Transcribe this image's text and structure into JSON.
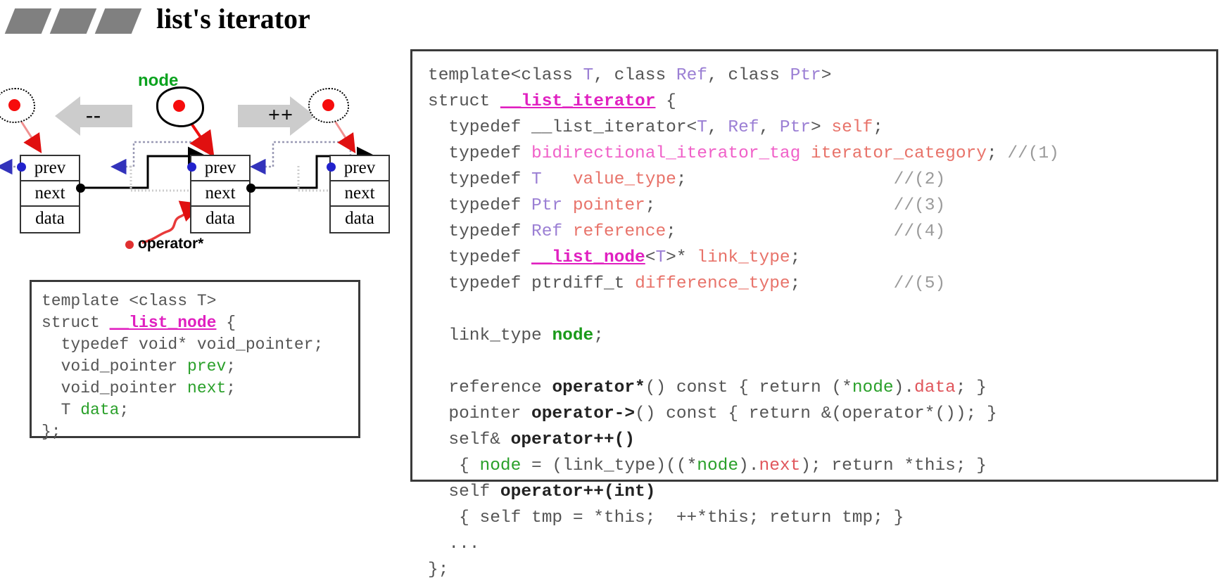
{
  "title": {
    "text": "list's iterator",
    "chevron_count": 3,
    "chevron_color": "#808080"
  },
  "diagram": {
    "node_label": "node",
    "node_label_color": "#0aa21e",
    "operator_star_label": "operator*",
    "decrement_sign": "--",
    "increment_sign": "++",
    "boxes": [
      {
        "name": "prev-node",
        "cells": [
          "prev",
          "next",
          "data"
        ]
      },
      {
        "name": "current-node",
        "cells": [
          "prev",
          "next",
          "data"
        ]
      },
      {
        "name": "next-node",
        "cells": [
          "prev",
          "next",
          "data"
        ]
      }
    ],
    "colors": {
      "iterator_dot": "#f60c0c",
      "prev_pointer_dot": "#2222cc",
      "next_pointer_dot": "#000000",
      "arrow_gray": "#cccccc",
      "operator_star_arrow": "#e03030"
    }
  },
  "code_list_node": {
    "lines": [
      [
        {
          "t": "template <class T>",
          "c": "plain"
        }
      ],
      [
        {
          "t": "struct ",
          "c": "plain"
        },
        {
          "t": "__list_node",
          "c": "magenta-u"
        },
        {
          "t": " {",
          "c": "plain"
        }
      ],
      [
        {
          "t": "  typedef void* void_pointer;",
          "c": "plain"
        }
      ],
      [
        {
          "t": "  void_pointer ",
          "c": "plain"
        },
        {
          "t": "prev",
          "c": "green"
        },
        {
          "t": ";",
          "c": "plain"
        }
      ],
      [
        {
          "t": "  void_pointer ",
          "c": "plain"
        },
        {
          "t": "next",
          "c": "green"
        },
        {
          "t": ";",
          "c": "plain"
        }
      ],
      [
        {
          "t": "  T ",
          "c": "plain"
        },
        {
          "t": "data",
          "c": "green"
        },
        {
          "t": ";",
          "c": "plain"
        }
      ],
      [
        {
          "t": "};",
          "c": "plain"
        }
      ]
    ]
  },
  "code_list_iterator": {
    "lines": [
      [
        {
          "t": "template<class ",
          "c": "plain"
        },
        {
          "t": "T",
          "c": "type"
        },
        {
          "t": ", class ",
          "c": "plain"
        },
        {
          "t": "Ref",
          "c": "type"
        },
        {
          "t": ", class ",
          "c": "plain"
        },
        {
          "t": "Ptr",
          "c": "type"
        },
        {
          "t": ">",
          "c": "plain"
        }
      ],
      [
        {
          "t": "struct ",
          "c": "plain"
        },
        {
          "t": "__list_iterator",
          "c": "magenta-u"
        },
        {
          "t": " {",
          "c": "plain"
        }
      ],
      [
        {
          "t": "  typedef __list_iterator<",
          "c": "plain"
        },
        {
          "t": "T",
          "c": "type"
        },
        {
          "t": ", ",
          "c": "plain"
        },
        {
          "t": "Ref",
          "c": "type"
        },
        {
          "t": ", ",
          "c": "plain"
        },
        {
          "t": "Ptr",
          "c": "type"
        },
        {
          "t": "> ",
          "c": "plain"
        },
        {
          "t": "self",
          "c": "typename"
        },
        {
          "t": ";",
          "c": "plain"
        }
      ],
      [
        {
          "t": "  typedef ",
          "c": "plain"
        },
        {
          "t": "bidirectional_iterator_tag",
          "c": "pink"
        },
        {
          "t": " ",
          "c": "plain"
        },
        {
          "t": "iterator_category",
          "c": "typename"
        },
        {
          "t": "; ",
          "c": "plain"
        },
        {
          "t": "//(1)",
          "c": "comment"
        }
      ],
      [
        {
          "t": "  typedef ",
          "c": "plain"
        },
        {
          "t": "T",
          "c": "type"
        },
        {
          "t": "   ",
          "c": "plain"
        },
        {
          "t": "value_type",
          "c": "typename"
        },
        {
          "t": ";                    ",
          "c": "plain"
        },
        {
          "t": "//(2)",
          "c": "comment"
        }
      ],
      [
        {
          "t": "  typedef ",
          "c": "plain"
        },
        {
          "t": "Ptr",
          "c": "type"
        },
        {
          "t": " ",
          "c": "plain"
        },
        {
          "t": "pointer",
          "c": "typename"
        },
        {
          "t": ";                       ",
          "c": "plain"
        },
        {
          "t": "//(3)",
          "c": "comment"
        }
      ],
      [
        {
          "t": "  typedef ",
          "c": "plain"
        },
        {
          "t": "Ref",
          "c": "type"
        },
        {
          "t": " ",
          "c": "plain"
        },
        {
          "t": "reference",
          "c": "typename"
        },
        {
          "t": ";                     ",
          "c": "plain"
        },
        {
          "t": "//(4)",
          "c": "comment"
        }
      ],
      [
        {
          "t": "  typedef ",
          "c": "plain"
        },
        {
          "t": "__list_node",
          "c": "magenta-u"
        },
        {
          "t": "<",
          "c": "plain"
        },
        {
          "t": "T",
          "c": "type"
        },
        {
          "t": ">* ",
          "c": "plain"
        },
        {
          "t": "link_type",
          "c": "typename"
        },
        {
          "t": ";",
          "c": "plain"
        }
      ],
      [
        {
          "t": "  typedef ptrdiff_t ",
          "c": "plain"
        },
        {
          "t": "difference_type",
          "c": "typename"
        },
        {
          "t": ";         ",
          "c": "plain"
        },
        {
          "t": "//(5)",
          "c": "comment"
        }
      ],
      [
        {
          "t": "",
          "c": "plain"
        }
      ],
      [
        {
          "t": "  link_type ",
          "c": "plain"
        },
        {
          "t": "node",
          "c": "green-b"
        },
        {
          "t": ";",
          "c": "plain"
        }
      ],
      [
        {
          "t": "",
          "c": "plain"
        }
      ],
      [
        {
          "t": "  reference ",
          "c": "plain"
        },
        {
          "t": "operator*",
          "c": "bold"
        },
        {
          "t": "() const { return (*",
          "c": "plain"
        },
        {
          "t": "node",
          "c": "green"
        },
        {
          "t": ").",
          "c": "plain"
        },
        {
          "t": "data",
          "c": "red"
        },
        {
          "t": "; }",
          "c": "plain"
        }
      ],
      [
        {
          "t": "  pointer ",
          "c": "plain"
        },
        {
          "t": "operator->",
          "c": "bold"
        },
        {
          "t": "() const { return &(",
          "c": "plain"
        },
        {
          "t": "operator*",
          "c": "plain"
        },
        {
          "t": "()); }",
          "c": "plain"
        }
      ],
      [
        {
          "t": "  self& ",
          "c": "plain"
        },
        {
          "t": "operator++()",
          "c": "bold"
        }
      ],
      [
        {
          "t": "   { ",
          "c": "plain"
        },
        {
          "t": "node",
          "c": "green"
        },
        {
          "t": " = (link_type)((*",
          "c": "plain"
        },
        {
          "t": "node",
          "c": "green"
        },
        {
          "t": ").",
          "c": "plain"
        },
        {
          "t": "next",
          "c": "red"
        },
        {
          "t": "); return *this; }",
          "c": "plain"
        }
      ],
      [
        {
          "t": "  self ",
          "c": "plain"
        },
        {
          "t": "operator++(int)",
          "c": "bold"
        }
      ],
      [
        {
          "t": "   { self tmp = *this;  ++*this; return tmp; }",
          "c": "plain"
        }
      ],
      [
        {
          "t": "  ...",
          "c": "plain"
        }
      ],
      [
        {
          "t": "};",
          "c": "plain"
        }
      ]
    ]
  }
}
